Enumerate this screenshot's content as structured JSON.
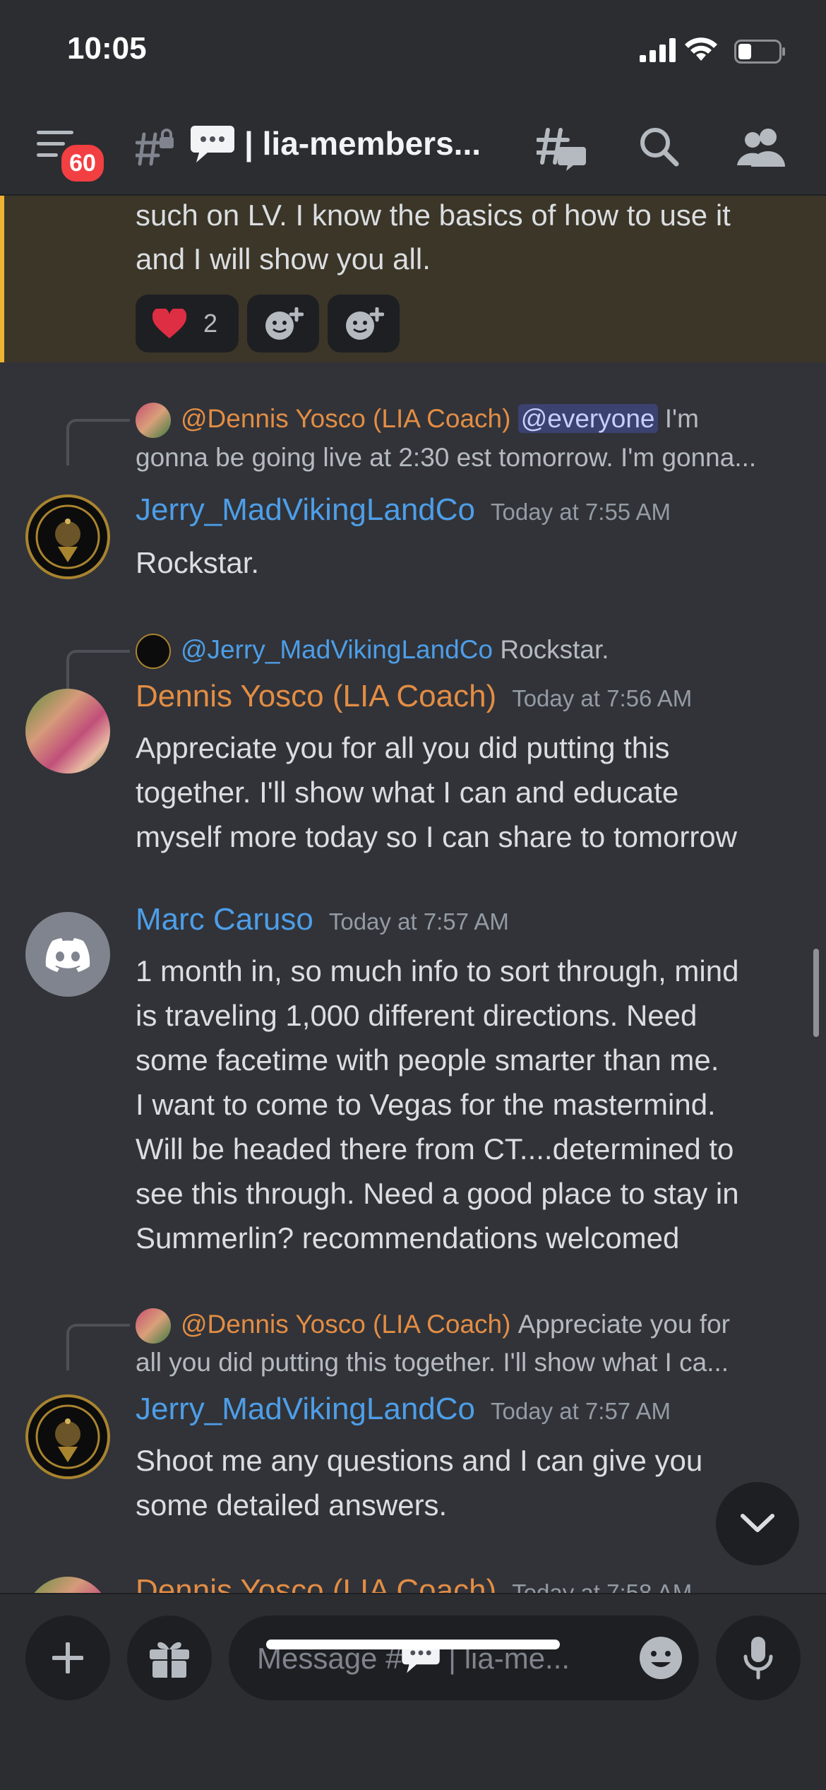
{
  "status_bar": {
    "time": "10:05"
  },
  "header": {
    "notification_count": "60",
    "channel_title": "| lia-members..."
  },
  "messages": {
    "highlighted": {
      "line1": "such on LV.  I know the basics of how to use it",
      "line2": "and I will show you all.",
      "reaction_heart_count": "2"
    },
    "m1": {
      "reply_author": "@Dennis Yosco (LIA Coach)",
      "reply_mention": "@everyone",
      "reply_line1_tail": "I'm",
      "reply_line2": "gonna be going live at 2:30 est tomorrow. I'm gonna...",
      "author": "Jerry_MadVikingLandCo",
      "timestamp": "Today at 7:55 AM",
      "line1": "Rockstar."
    },
    "m2": {
      "reply_author": "@Jerry_MadVikingLandCo",
      "reply_text": "Rockstar.",
      "author": "Dennis Yosco (LIA Coach)",
      "timestamp": "Today at 7:56 AM",
      "line1": "Appreciate you for all you did putting this",
      "line2": "together. I'll show what I can and educate",
      "line3": "myself more today so I can share to tomorrow"
    },
    "m3": {
      "author": "Marc Caruso",
      "timestamp": "Today at 7:57 AM",
      "line1": "1 month in, so much info to sort through, mind",
      "line2": "is traveling 1,000 different directions.  Need",
      "line3": "some facetime with people smarter than me.",
      "line4": "I want to come to Vegas for the mastermind.",
      "line5": "Will be headed there from CT....determined to",
      "line6": "see this through.  Need a good place to stay in",
      "line7": "Summerlin?  recommendations welcomed"
    },
    "m4": {
      "reply_author": "@Dennis Yosco (LIA Coach)",
      "reply_line1_tail": "Appreciate you for",
      "reply_line2": "all you did putting this together. I'll show what I ca...",
      "author": "Jerry_MadVikingLandCo",
      "timestamp": "Today at 7:57 AM",
      "line1": "Shoot me any questions and I can give you",
      "line2": "some detailed answers."
    },
    "m5_partial": {
      "author": "Dennis Yosco (LIA Coach)",
      "timestamp": "Today at 7:58 AM"
    }
  },
  "composer": {
    "placeholder_prefix": "Message #",
    "placeholder_suffix": " | lia-me..."
  },
  "colors": {
    "background": "#313338",
    "highlight_bg": "#3b3628",
    "highlight_bar": "#f0b232",
    "coach_name": "#e38d44",
    "member_name": "#4d9ee8",
    "badge": "#f23f42"
  },
  "icons": [
    "hamburger-icon",
    "hash-lock-icon",
    "speech-bubble-icon",
    "threads-icon",
    "search-icon",
    "members-icon",
    "heart-icon",
    "add-reaction-icon",
    "add-super-reaction-icon",
    "chevron-down-icon",
    "plus-icon",
    "gift-icon",
    "emoji-icon",
    "microphone-icon"
  ]
}
